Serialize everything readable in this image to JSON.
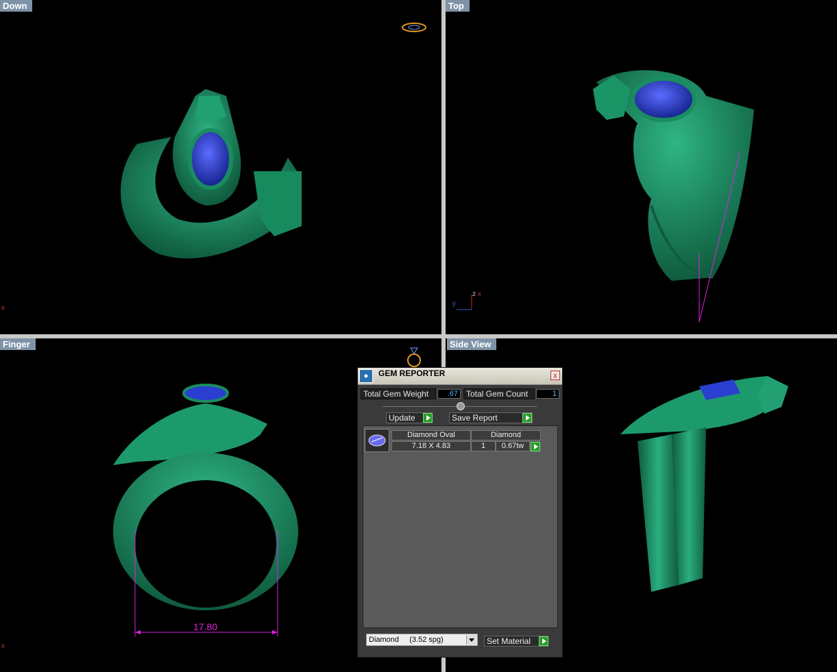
{
  "viewports": {
    "down": {
      "label": "Down"
    },
    "top": {
      "label": "Top"
    },
    "finger": {
      "label": "Finger"
    },
    "side": {
      "label": "Side View"
    }
  },
  "axes": {
    "x": "x",
    "y": "y",
    "z": "z"
  },
  "dimension": {
    "value": "17.80"
  },
  "gem_reporter": {
    "title": "GEM REPORTER",
    "close": "x",
    "total_weight_label": "Total Gem Weight",
    "total_weight_value": ".67",
    "total_count_label": "Total Gem Count",
    "total_count_value": "1",
    "update_label": "Update",
    "save_report_label": "Save Report",
    "gem": {
      "shape": "Diamond Oval",
      "material": "Diamond",
      "size": "7.18 X 4.83",
      "qty": "1",
      "weight": "0.67tw"
    },
    "material_select": "Diamond     (3.52 spg)",
    "set_material_label": "Set Material"
  },
  "colors": {
    "metal": "#1f8f65",
    "gem": "#2a3fd0",
    "dimension": "#e020e0",
    "label_bg": "#7f93a8"
  }
}
